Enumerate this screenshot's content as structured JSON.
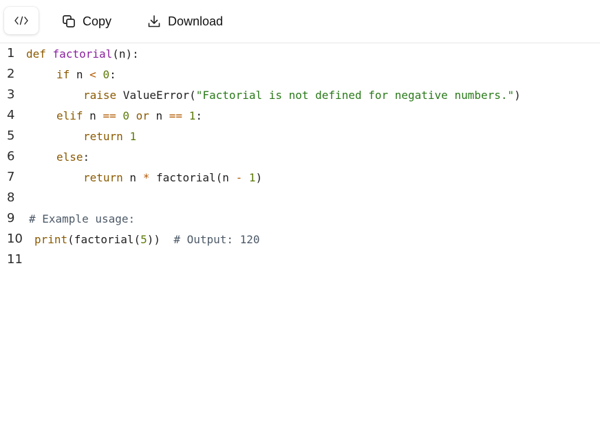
{
  "toolbar": {
    "code_toggle_icon": "code-brackets-icon",
    "copy_label": "Copy",
    "copy_icon": "copy-icon",
    "download_label": "Download",
    "download_icon": "download-icon"
  },
  "code": {
    "language": "python",
    "lines": [
      {
        "number": "1",
        "tokens": [
          {
            "t": "def",
            "c": "kw"
          },
          {
            "t": " ",
            "c": "pl"
          },
          {
            "t": "factorial",
            "c": "fn"
          },
          {
            "t": "(n):",
            "c": "pl"
          }
        ]
      },
      {
        "number": "2",
        "tokens": [
          {
            "t": "if",
            "c": "kw"
          },
          {
            "t": " n ",
            "c": "pl"
          },
          {
            "t": "<",
            "c": "op"
          },
          {
            "t": " ",
            "c": "pl"
          },
          {
            "t": "0",
            "c": "num"
          },
          {
            "t": ":",
            "c": "pl"
          }
        ]
      },
      {
        "number": "3",
        "tokens": [
          {
            "t": "raise",
            "c": "kw"
          },
          {
            "t": " ValueError(",
            "c": "pl"
          },
          {
            "t": "\"Factorial is not defined for negative numbers.\"",
            "c": "str"
          },
          {
            "t": ")",
            "c": "pl"
          }
        ]
      },
      {
        "number": "4",
        "tokens": [
          {
            "t": "elif",
            "c": "kw"
          },
          {
            "t": " n ",
            "c": "pl"
          },
          {
            "t": "==",
            "c": "op"
          },
          {
            "t": " ",
            "c": "pl"
          },
          {
            "t": "0",
            "c": "num"
          },
          {
            "t": " ",
            "c": "pl"
          },
          {
            "t": "or",
            "c": "kw"
          },
          {
            "t": " n ",
            "c": "pl"
          },
          {
            "t": "==",
            "c": "op"
          },
          {
            "t": " ",
            "c": "pl"
          },
          {
            "t": "1",
            "c": "num"
          },
          {
            "t": ":",
            "c": "pl"
          }
        ]
      },
      {
        "number": "5",
        "tokens": [
          {
            "t": "return",
            "c": "kw"
          },
          {
            "t": " ",
            "c": "pl"
          },
          {
            "t": "1",
            "c": "num"
          }
        ]
      },
      {
        "number": "6",
        "tokens": [
          {
            "t": "else",
            "c": "kw"
          },
          {
            "t": ":",
            "c": "pl"
          }
        ]
      },
      {
        "number": "7",
        "tokens": [
          {
            "t": "return",
            "c": "kw"
          },
          {
            "t": " n ",
            "c": "pl"
          },
          {
            "t": "*",
            "c": "op"
          },
          {
            "t": " factorial(n ",
            "c": "pl"
          },
          {
            "t": "-",
            "c": "op"
          },
          {
            "t": " ",
            "c": "pl"
          },
          {
            "t": "1",
            "c": "num"
          },
          {
            "t": ")",
            "c": "pl"
          }
        ]
      },
      {
        "number": "8",
        "tokens": []
      },
      {
        "number": "9",
        "tokens": [
          {
            "t": "# Example usage:",
            "c": "cm"
          }
        ]
      },
      {
        "number": "10",
        "tokens": [
          {
            "t": "print",
            "c": "kw"
          },
          {
            "t": "(factorial(",
            "c": "pl"
          },
          {
            "t": "5",
            "c": "num"
          },
          {
            "t": "))  ",
            "c": "pl"
          },
          {
            "t": "# Output: 120",
            "c": "cm"
          }
        ]
      },
      {
        "number": "11",
        "tokens": []
      }
    ]
  },
  "colors": {
    "keyword": "#8a5a00",
    "function": "#8b1fa0",
    "operator": "#b35900",
    "number": "#5c7a0a",
    "string": "#2a7a1a",
    "comment": "#4d5a68"
  }
}
